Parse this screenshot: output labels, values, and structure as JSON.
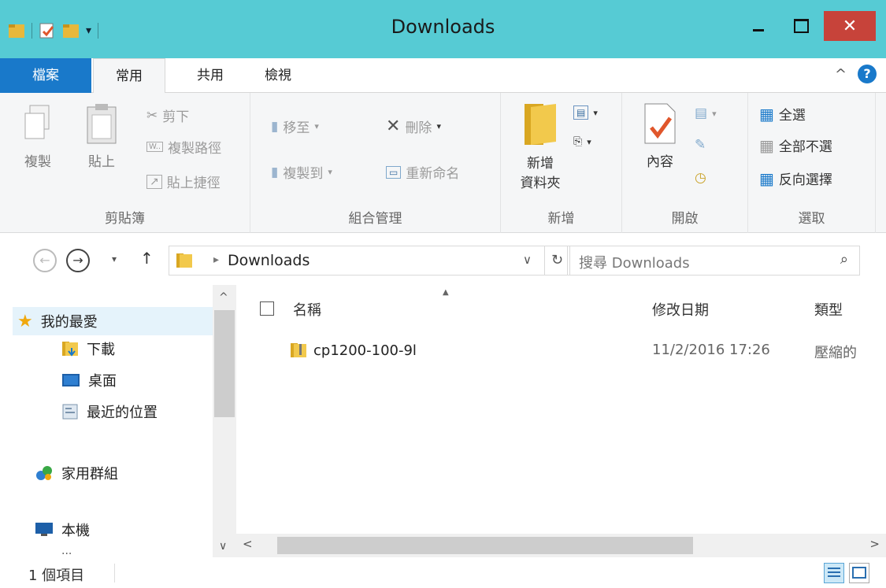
{
  "window": {
    "title": "Downloads",
    "close_glyph": "✕"
  },
  "ribbon_tabs": {
    "file": "檔案",
    "home": "常用",
    "share": "共用",
    "view": "檢視"
  },
  "ribbon": {
    "clipboard": {
      "label": "剪貼簿",
      "copy": "複製",
      "paste": "貼上",
      "cut": "剪下",
      "copy_path": "複製路徑",
      "paste_shortcut": "貼上捷徑"
    },
    "organize": {
      "label": "組合管理",
      "move_to": "移至",
      "copy_to": "複製到",
      "delete": "刪除",
      "rename": "重新命名"
    },
    "new": {
      "label": "新增",
      "new_folder_line1": "新增",
      "new_folder_line2": "資料夾"
    },
    "open": {
      "label": "開啟",
      "properties": "內容"
    },
    "select": {
      "label": "選取",
      "select_all": "全選",
      "select_none": "全部不選",
      "invert": "反向選擇"
    }
  },
  "address": {
    "path": "Downloads",
    "search_placeholder": "搜尋 Downloads"
  },
  "nav": {
    "favorites": "我的最愛",
    "downloads": "下載",
    "desktop": "桌面",
    "recent": "最近的位置",
    "homegroup": "家用群組",
    "this_pc": "本機",
    "cutoff": "..."
  },
  "columns": {
    "name": "名稱",
    "date": "修改日期",
    "type": "類型"
  },
  "files": [
    {
      "name": "cp1200-100-9l",
      "date": "11/2/2016 17:26",
      "type": "壓縮的"
    }
  ],
  "status": {
    "count": "1 個項目"
  },
  "colors": {
    "titlebar": "#56cbd4",
    "file_tab": "#1979ca",
    "close": "#c7433a"
  },
  "icons": [
    "folder-icon",
    "zip-folder-icon",
    "star-icon",
    "search-icon",
    "refresh-icon",
    "help-icon"
  ]
}
